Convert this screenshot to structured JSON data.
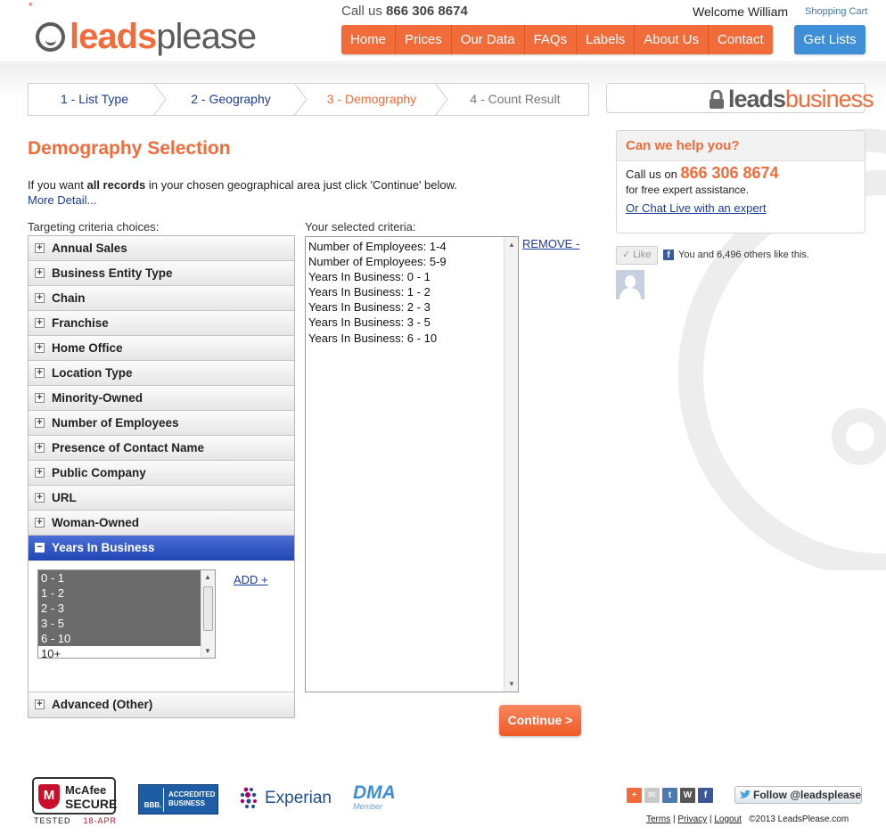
{
  "header": {
    "asterisk": "*",
    "logo_part1": "leads",
    "logo_part2": "please",
    "call_prefix": "Call us",
    "phone": "866 306 8674",
    "welcome": "Welcome William",
    "shopping_cart": "Shopping Cart",
    "nav": [
      "Home",
      "Prices",
      "Our Data",
      "FAQs",
      "Labels",
      "About Us",
      "Contact"
    ],
    "get_lists": "Get Lists"
  },
  "steps": [
    {
      "label": "1 - List Type",
      "state": "done"
    },
    {
      "label": "2 - Geography",
      "state": "done"
    },
    {
      "label": "3 - Demography",
      "state": "active"
    },
    {
      "label": "4 - Count Result",
      "state": "future"
    }
  ],
  "leadsbusiness": {
    "part1": "leads",
    "part2": "business"
  },
  "main": {
    "title": "Demography Selection",
    "intro_pre": "If you want ",
    "intro_bold": "all records",
    "intro_post": " in your chosen geographical area just click 'Continue' below.",
    "more_detail": "More Detail...",
    "targeting_label": "Targeting criteria choices:",
    "selected_label": "Your selected criteria:",
    "criteria": [
      "Annual Sales",
      "Business Entity Type",
      "Chain",
      "Franchise",
      "Home Office",
      "Location Type",
      "Minority-Owned",
      "Number of Employees",
      "Presence of Contact Name",
      "Public Company",
      "URL",
      "Woman-Owned"
    ],
    "open_criterion": "Years In Business",
    "open_options": [
      {
        "label": "0 - 1",
        "selected": true
      },
      {
        "label": "1 - 2",
        "selected": true
      },
      {
        "label": "2 - 3",
        "selected": true
      },
      {
        "label": "3 - 5",
        "selected": true
      },
      {
        "label": "6 - 10",
        "selected": true
      },
      {
        "label": "10+",
        "selected": false
      }
    ],
    "add_label": "ADD +",
    "last_criterion": "Advanced (Other)",
    "selected_items": [
      "Number of Employees: 1-4",
      "Number of Employees: 5-9",
      "Years In Business: 0 - 1",
      "Years In Business: 1 - 2",
      "Years In Business: 2 - 3",
      "Years In Business: 3 - 5",
      "Years In Business: 6 - 10"
    ],
    "remove_label": "REMOVE -",
    "continue_label": "Continue >"
  },
  "help": {
    "heading": "Can we help you?",
    "call_prefix": "Call us on",
    "phone": "866 306 8674",
    "assist": "for free expert assistance.",
    "chat": "Or Chat Live with an expert"
  },
  "facebook": {
    "like": "Like",
    "text": "You and 6,496 others like this."
  },
  "footer": {
    "mcafee_line1": "McAfee",
    "mcafee_line2": "SECURE",
    "mcafee_tested": "TESTED",
    "mcafee_date": "18-APR",
    "bbb_left": "BBB.",
    "bbb_right1": "ACCREDITED",
    "bbb_right2": "BUSINESS",
    "experian": "Experian",
    "dma": "DMA",
    "dma_sub": "Member",
    "follow": "Follow @leadsplease",
    "links": [
      "Terms",
      "Privacy",
      "Logout"
    ],
    "copyright": "©2013 LeadsPlease.com"
  },
  "colors": {
    "brand_orange": "#f26b3a",
    "brand_blue": "#3f8ed8",
    "open_blue": "#2347b5"
  }
}
